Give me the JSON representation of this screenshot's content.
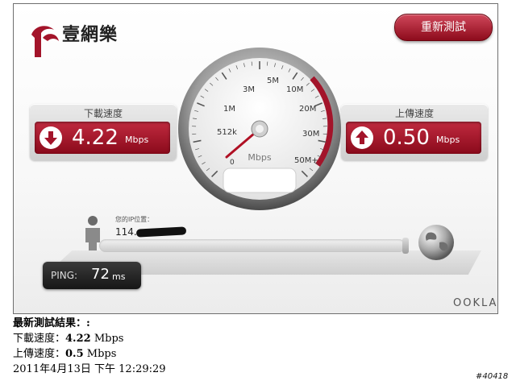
{
  "app": {
    "brand": "壹網樂",
    "retest_label": "重新測試",
    "ookla_logo": "OOKLA"
  },
  "download": {
    "title": "下載速度",
    "value": "4.22",
    "unit": "Mbps",
    "icon": "download-arrow-icon"
  },
  "upload": {
    "title": "上傳速度",
    "value": "0.50",
    "unit": "Mbps",
    "icon": "upload-arrow-icon"
  },
  "gauge": {
    "ticks": [
      "0",
      "512k",
      "1M",
      "3M",
      "5M",
      "10M",
      "20M",
      "30M",
      "50M+"
    ],
    "unit": "Mbps",
    "current_mbps": 4.22
  },
  "ip": {
    "label": "您的IP位置：",
    "value_prefix": "114."
  },
  "ping": {
    "label": "PING:",
    "value": "72",
    "unit": "ms"
  },
  "results": {
    "heading": "最新測試結果：:",
    "download_label": "下載速度：",
    "download_value": "4.22",
    "download_unit": " Mbps",
    "upload_label": "上傳速度：",
    "upload_value": "0.5",
    "upload_unit": " Mbps",
    "timestamp": "2011年4月13日 下午 12:29:29"
  },
  "watermark": "#40418",
  "colors": {
    "accent": "#a3142a",
    "panel_bg": "#d9d9d9",
    "ping_bg": "#1f1f1f"
  }
}
